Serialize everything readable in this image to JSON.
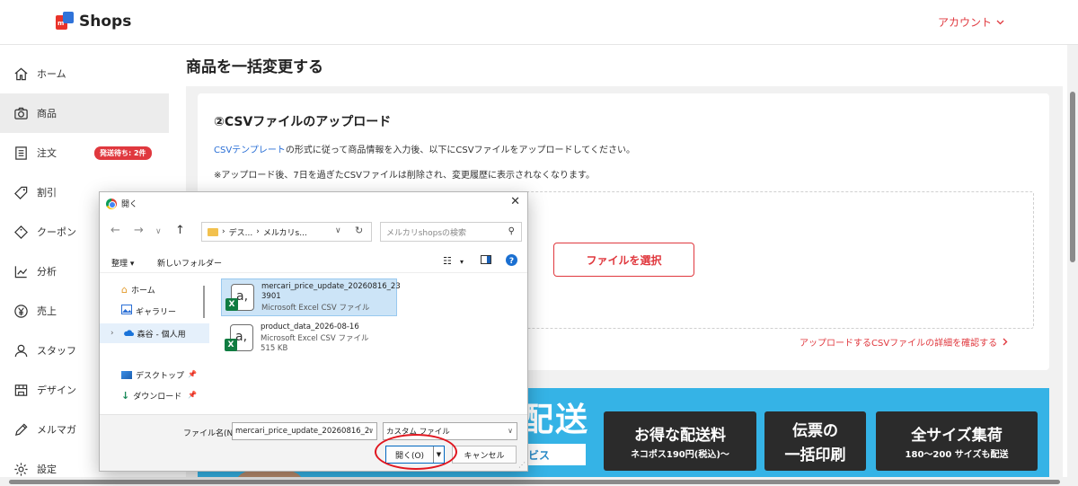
{
  "header": {
    "logo_text": "Shops",
    "logo_m": "m",
    "account_label": "アカウント"
  },
  "sidebar": {
    "items": [
      {
        "label": "ホーム",
        "icon": "home-icon"
      },
      {
        "label": "商品",
        "icon": "camera-icon",
        "active": true
      },
      {
        "label": "注文",
        "icon": "order-list-icon",
        "badge": "発送待ち: 2件"
      },
      {
        "label": "割引",
        "icon": "tag-icon"
      },
      {
        "label": "クーポン",
        "icon": "coupon-icon"
      },
      {
        "label": "分析",
        "icon": "chart-icon"
      },
      {
        "label": "売上",
        "icon": "yen-icon"
      },
      {
        "label": "スタッフ",
        "icon": "person-icon"
      },
      {
        "label": "デザイン",
        "icon": "store-icon"
      },
      {
        "label": "メルマガ",
        "icon": "pen-icon"
      },
      {
        "label": "設定",
        "icon": "gear-icon"
      }
    ]
  },
  "main": {
    "page_title": "商品を一括変更する",
    "card_title": "②CSVファイルのアップロード",
    "desc_link": "CSVテンプレート",
    "desc_rest": "の形式に従って商品情報を入力後、以下にCSVファイルをアップロードしてください。",
    "desc2": "※アップロード後、7日を過ぎたCSVファイルは削除され、変更履歴に表示されなくなります。",
    "select_file_button": "ファイルを選択",
    "detail_link": "アップロードするCSVファイルの詳細を確認する"
  },
  "banner": {
    "big_text": "配送",
    "white_text": "ビス",
    "boxes": [
      {
        "big": "お得な配送料",
        "small": "ネコポス190円(税込)〜"
      },
      {
        "big": "伝票の",
        "small": "一括印刷"
      },
      {
        "big": "全サイズ集荷",
        "small": "180〜200 サイズも配送"
      }
    ]
  },
  "dialog": {
    "title": "開く",
    "path_seg1": "デス...",
    "path_seg2": "メルカリs...",
    "search_placeholder": "メルカリshopsの検索",
    "toolbar_organize": "整理",
    "toolbar_new_folder": "新しいフォルダー",
    "nav": {
      "home": "ホーム",
      "gallery": "ギャラリー",
      "onedrive": "森谷 - 個人用",
      "desktop": "デスクトップ",
      "downloads": "ダウンロード"
    },
    "files": [
      {
        "name_line1": "mercari_price_update_20260816_23",
        "name_line2": "3901",
        "type": "Microsoft Excel CSV ファイル",
        "size": ""
      },
      {
        "name_line1": "product_data_2026-08-16",
        "name_line2": "",
        "type": "Microsoft Excel CSV ファイル",
        "size": "515 KB"
      }
    ],
    "filename_label": "ファイル名(N):",
    "filename_value": "mercari_price_update_20260816_2:",
    "filetype_value": "カスタム ファイル",
    "open_button": "開く(O)",
    "cancel_button": "キャンセル"
  },
  "colors": {
    "accent": "#e0383e",
    "link": "#2a6fd6",
    "banner": "#35b3e6"
  }
}
